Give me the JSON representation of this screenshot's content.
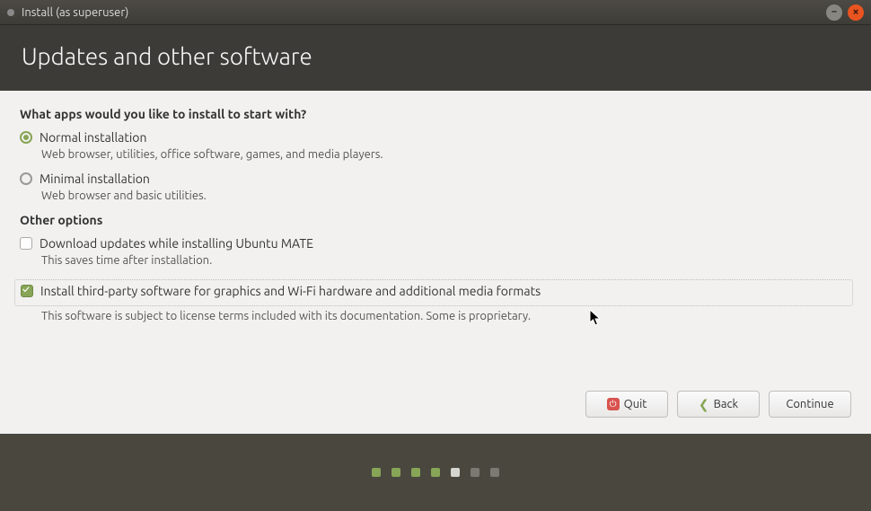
{
  "window": {
    "title": "Install (as superuser)"
  },
  "header": {
    "title": "Updates and other software"
  },
  "question": "What apps would you like to install to start with?",
  "options": {
    "normal": {
      "label": "Normal installation",
      "desc": "Web browser, utilities, office software, games, and media players.",
      "selected": true
    },
    "minimal": {
      "label": "Minimal installation",
      "desc": "Web browser and basic utilities.",
      "selected": false
    }
  },
  "other": {
    "heading": "Other options",
    "download": {
      "label": "Download updates while installing Ubuntu MATE",
      "desc": "This saves time after installation.",
      "checked": false
    },
    "thirdparty": {
      "label": "Install third-party software for graphics and Wi-Fi hardware and additional media formats",
      "desc": "This software is subject to license terms included with its documentation. Some is proprietary.",
      "checked": true
    }
  },
  "buttons": {
    "quit": "Quit",
    "back": "Back",
    "continue": "Continue"
  },
  "pager": {
    "total": 7,
    "completed": 4,
    "current": 5
  }
}
